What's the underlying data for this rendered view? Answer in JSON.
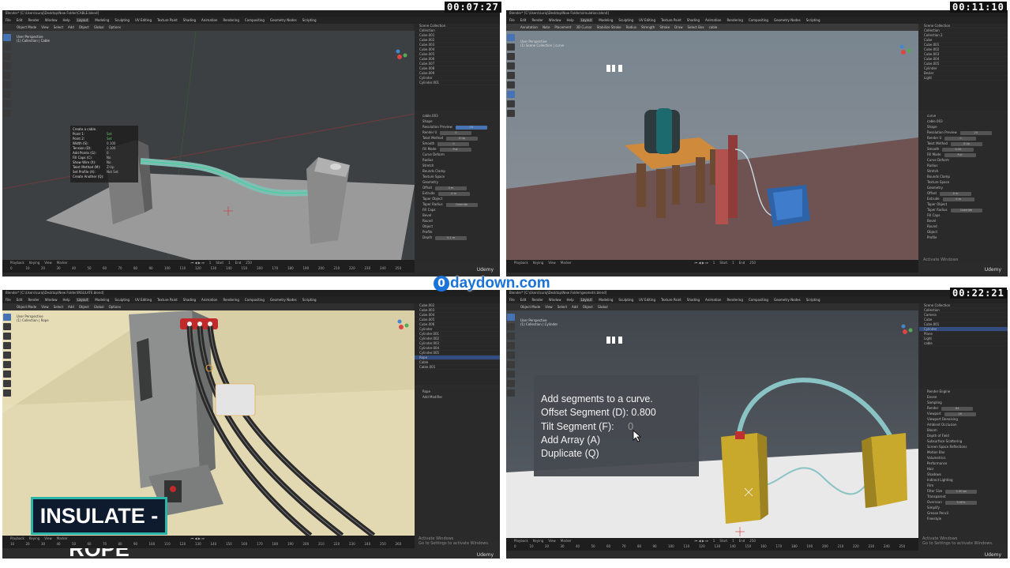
{
  "timecodes": [
    "00:07:27",
    "00:11:10",
    "00:22:21"
  ],
  "watermark": {
    "text": "daydown.com",
    "badge": "0"
  },
  "panel1": {
    "title": "Blender* [C:\\Users\\suraj\\Desktop\\New Folder\\CABLE.blend]",
    "menu": [
      "File",
      "Edit",
      "Render",
      "Window",
      "Help",
      "Layout",
      "Modeling",
      "Sculpting",
      "UV Editing",
      "Texture Paint",
      "Shading",
      "Animation",
      "Rendering",
      "Compositing",
      "Geometry Nodes",
      "Scripting"
    ],
    "active_tab": "Layout",
    "header": [
      "Object Mode",
      "View",
      "Select",
      "Add",
      "Object",
      "Global",
      "Options"
    ],
    "view_info": [
      "User Perspective",
      "(1) Collection | Cable"
    ],
    "hud_lines": [
      "Create a cable.",
      "Point 1:",
      "Point 2:",
      "Width (S):",
      "Tension (D):",
      "Add Points (G):",
      "Fill Caps (C):",
      "Show Wire (X):",
      "Twist Method (M):",
      "Set Profile (A):",
      "Create Another (Q):"
    ],
    "hud_values": [
      "",
      "Set",
      "Set",
      "0.100",
      "0.100",
      "0",
      "No",
      "No",
      "Z-Up",
      "Not Set",
      ""
    ],
    "outliner": [
      "Scene Collection",
      "Collection",
      "Cube.001",
      "Cube.002",
      "Cube.003",
      "Cube.004",
      "Cube.005",
      "Cube.006",
      "Cube.007",
      "Cube.008",
      "Cube.009",
      "Cylinder",
      "Cylinder.001"
    ],
    "props": [
      "cable.003",
      "Shape",
      "Resolution Preview",
      "Render U",
      "Twist Method",
      "Smooth",
      "Fill Mode",
      "Curve Deform",
      "Radius",
      "Stretch",
      "Bounds Clamp",
      "Texture Space",
      "Geometry",
      "Offset",
      "Extrude",
      "Taper Object",
      "Taper Radius",
      "Fill Caps",
      "Bevel",
      "Round",
      "Object",
      "Profile",
      "Depth"
    ],
    "props_values": [
      "",
      "",
      "20",
      "0",
      "Z-Up",
      "0",
      "Full",
      "",
      "",
      "",
      "",
      "",
      "",
      "0 m",
      "0 m",
      "",
      "Override",
      "",
      "",
      "",
      "",
      "",
      "0.1 m"
    ],
    "timeline": [
      "Playback",
      "Keying",
      "View",
      "Marker"
    ],
    "timeline_values": [
      "1",
      "Start",
      "1",
      "End",
      "250"
    ],
    "ticks": [
      "0",
      "10",
      "20",
      "30",
      "40",
      "50",
      "60",
      "70",
      "80",
      "90",
      "100",
      "110",
      "120",
      "130",
      "140",
      "150",
      "160",
      "170",
      "180",
      "190",
      "200",
      "210",
      "220",
      "230",
      "240",
      "250"
    ],
    "udemy": "Udemy"
  },
  "panel2": {
    "title": "Blender* [C:\\Users\\suraj\\Desktop\\New Folder\\simulation.blend]",
    "menu": [
      "File",
      "Edit",
      "Render",
      "Window",
      "Help",
      "Layout",
      "Modeling",
      "Sculpting",
      "UV Editing",
      "Texture Paint",
      "Shading",
      "Animation",
      "Rendering",
      "Compositing",
      "Geometry Nodes",
      "Scripting"
    ],
    "active_tab": "Layout",
    "header": [
      "Annotation",
      "Note",
      "Placement",
      "3D Cursor",
      "Stabilize Stroke",
      "Radius",
      "Strength",
      "Stroke",
      "Draw",
      "Select Box",
      "cable"
    ],
    "view_info": [
      "User Perspective",
      "(1) Scene Collection | curve"
    ],
    "outliner": [
      "Scene Collection",
      "Collection",
      "Collection 2",
      "Cube",
      "Cube.001",
      "Cube.002",
      "Cube.003",
      "Cube.004",
      "Cube.005",
      "Cylinder",
      "Bezier",
      "Light"
    ],
    "props": [
      "curve",
      "cable.003",
      "Shape",
      "Resolution Preview",
      "Render U",
      "Twist Method",
      "Smooth",
      "Fill Mode",
      "Curve Deform",
      "Radius",
      "Stretch",
      "Bounds Clamp",
      "Texture Space",
      "Geometry",
      "Offset",
      "Extrude",
      "Taper Object",
      "Taper Radius",
      "Fill Caps",
      "Bevel",
      "Round",
      "Object",
      "Profile"
    ],
    "props_values": [
      "",
      "",
      "",
      "20",
      "0",
      "Z-Up",
      "0.00",
      "Full",
      "",
      "",
      "",
      "",
      "",
      "",
      "0 m",
      "0 m",
      "",
      "Override",
      "",
      "",
      "",
      "",
      ""
    ],
    "timeline": [
      "Playback",
      "Keying",
      "View",
      "Marker"
    ],
    "timeline_values": [
      "1",
      "Start",
      "1",
      "End",
      "250"
    ],
    "activate": [
      "Activate Windows",
      "Go to Settings to activate Windows."
    ],
    "udemy": "Udemy"
  },
  "panel3": {
    "title": "Blender* [C:\\Users\\suraj\\Desktop\\New Folder\\INSULATE.blend]",
    "menu": [
      "File",
      "Edit",
      "Render",
      "Window",
      "Help",
      "Layout",
      "Modeling",
      "Sculpting",
      "UV Editing",
      "Texture Paint",
      "Shading",
      "Animation",
      "Rendering",
      "Compositing",
      "Geometry Nodes",
      "Scripting"
    ],
    "active_tab": "Layout",
    "header": [
      "Object Mode",
      "View",
      "Select",
      "Add",
      "Object",
      "Global",
      "Options"
    ],
    "view_info": [
      "User Perspective",
      "(1) Collection | Rope"
    ],
    "outliner": [
      "Cube.002",
      "Cube.003",
      "Cube.004",
      "Cube.005",
      "Cube.006",
      "Cylinder",
      "Cylinder.001",
      "Cylinder.002",
      "Cylinder.003",
      "Cylinder.004",
      "Cylinder.005",
      "Rope",
      "Cable",
      "Cable.001"
    ],
    "outliner_selected": "Rope",
    "props": [
      "Rope",
      "Add Modifier"
    ],
    "banner": "INSULATE -ROPE",
    "timeline": [
      "Playback",
      "Keying",
      "View",
      "Marker"
    ],
    "ticks": [
      "10",
      "20",
      "30",
      "40",
      "50",
      "60",
      "70",
      "80",
      "90",
      "100",
      "110",
      "120",
      "130",
      "140",
      "150",
      "160",
      "170",
      "180",
      "190",
      "200",
      "210",
      "220",
      "230",
      "240",
      "250",
      "260"
    ],
    "activate": [
      "Activate Windows",
      "Go to Settings to activate Windows."
    ],
    "udemy": "Udemy"
  },
  "panel4": {
    "title": "Blender* [C:\\Users\\suraj\\Desktop\\New Folder\\geometri.blend]",
    "menu": [
      "File",
      "Edit",
      "Render",
      "Window",
      "Help",
      "Layout",
      "Modeling",
      "Sculpting",
      "UV Editing",
      "Texture Paint",
      "Shading",
      "Animation",
      "Rendering",
      "Compositing",
      "Geometry Nodes",
      "Scripting"
    ],
    "active_tab": "Layout",
    "header": [
      "Object Mode",
      "View",
      "Select",
      "Add",
      "Object",
      "Global"
    ],
    "view_info": [
      "User Perspective",
      "(1) Collection | Cylinder"
    ],
    "hud_lines": [
      "Add segments to a curve.",
      "Offset Segment (D): 0.800",
      "Tilt Segment (F):",
      "Add Array (A)",
      "Duplicate (Q)"
    ],
    "hud_tilt_value": "0",
    "outliner": [
      "Scene Collection",
      "Collection",
      "Camera",
      "Cube",
      "Cube.001",
      "Cylinder",
      "Plane",
      "Light",
      "cable"
    ],
    "outliner_selected": "Cylinder",
    "props": [
      "Render Engine",
      "Eevee",
      "Sampling",
      "Render",
      "Viewport",
      "Viewport Denoising",
      "Ambient Occlusion",
      "Bloom",
      "Depth of Field",
      "Subsurface Scattering",
      "Screen Space Reflections",
      "Motion Blur",
      "Volumetrics",
      "Performance",
      "Hair",
      "Shadows",
      "Indirect Lighting",
      "Film",
      "Filter Size",
      "Transparent",
      "Overscan",
      "Simplify",
      "Grease Pencil",
      "Freestyle"
    ],
    "props_values": [
      "",
      "",
      "",
      "64",
      "16",
      "",
      "",
      "",
      "",
      "",
      "",
      "",
      "",
      "",
      "",
      "",
      "",
      "",
      "1.50 px",
      "",
      "3.00%",
      "",
      "",
      ""
    ],
    "timeline": [
      "Playback",
      "Keying",
      "View",
      "Marker"
    ],
    "timeline_values": [
      "1",
      "Start",
      "1",
      "End",
      "250"
    ],
    "ticks": [
      "0",
      "10",
      "20",
      "30",
      "40",
      "50",
      "60",
      "70",
      "80",
      "90",
      "100",
      "110",
      "120",
      "130",
      "140",
      "150",
      "160",
      "170",
      "180",
      "190",
      "200",
      "210",
      "220",
      "230",
      "240",
      "250"
    ],
    "activate": [
      "Activate Windows",
      "Go to Settings to activate Windows."
    ],
    "udemy": "Udemy"
  },
  "colors": {
    "accent": "#4772b3",
    "cable": "#6fb8b0",
    "watermark": "#1a73d9",
    "banner_border": "#2bb5a8"
  }
}
